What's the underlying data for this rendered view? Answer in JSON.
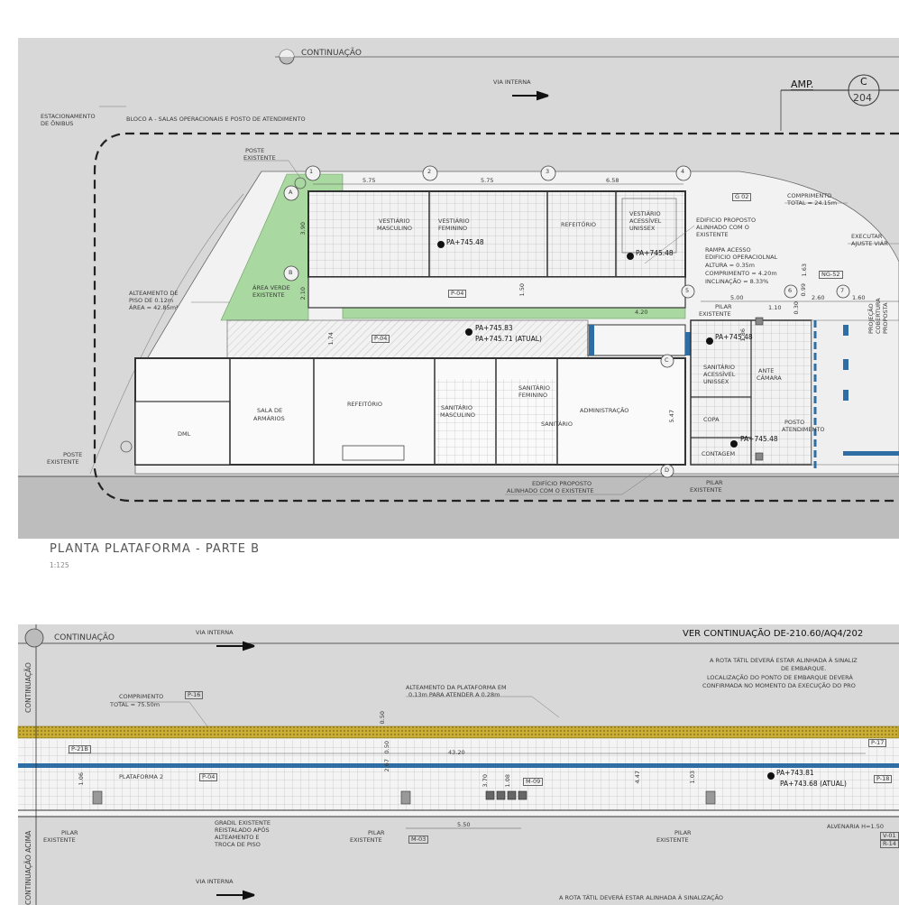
{
  "top": {
    "continuation": "CONTINUAÇÃO",
    "via_interna": "VIA INTERNA",
    "amp_label": "AMP.",
    "amp_letter": "C",
    "amp_number": "204",
    "estacionamento": "ESTACIONAMENTO",
    "de_onibus": "DE ÔNIBUS",
    "bloco": "BLOCO A - SALAS OPERACIONAIS E POSTO DE ATENDIMENTO",
    "poste_existente_1": "POSTE",
    "poste_existente_2": "EXISTENTE",
    "poste_bottom_1": "POSTE",
    "poste_bottom_2": "EXISTENTE",
    "grid_numbers": [
      "1",
      "2",
      "3",
      "4",
      "5",
      "6",
      "7"
    ],
    "grid_letters": [
      "A",
      "B",
      "C",
      "D"
    ],
    "dims": {
      "d1": "5.75",
      "d2": "5.75",
      "d3": "6.58",
      "d420": "4.20",
      "d500": "5.00",
      "d110": "1.10",
      "d260": "2.60",
      "d160": "1.60",
      "v390": "3.90",
      "v210": "2.10",
      "v150": "1.50",
      "v174": "1.74",
      "v186": "1.86",
      "v547": "5.47",
      "v163": "1.63",
      "v099": "0.99",
      "v030": "0.30"
    },
    "alteamento_1": "ALTEAMENTO DE",
    "alteamento_2": "PISO DE 0.12m",
    "alteamento_3": "ÁREA = 42.85m²",
    "area_verde_1": "ÁREA VERDE",
    "area_verde_2": "EXISTENTE",
    "vest_masc_1": "VESTIÁRIO",
    "vest_masc_2": "MASCULINO",
    "vest_fem_1": "VESTIÁRIO",
    "vest_fem_2": "FEMININO",
    "refeitorio": "REFEITÓRIO",
    "vest_acess_1": "VESTIÁRIO",
    "vest_acess_2": "ACESSÍVEL",
    "vest_acess_3": "UNISSEX",
    "pa_1": "PA+745.48",
    "pa_2": "PA+745.48",
    "pa_3": "PA+745.83",
    "pa_4": "PA+745.71  (ATUAL)",
    "pa_5": "PA+745.48",
    "pa_6": "PA+745.48",
    "p04a": "P-04",
    "p04b": "P-04",
    "g02": "G 02",
    "ng52": "NG-52",
    "comprimento_1": "COMPRIMENTO",
    "comprimento_2": "TOTAL = 24.15m",
    "executar_1": "EXECUTAR",
    "executar_2": "AJUSTE VIÁR",
    "edif_prop_1": "EDIFICIO PROPOSTO",
    "edif_prop_2": "ALINHADO COM O",
    "edif_prop_3": "EXISTENTE",
    "rampa_1": "RAMPA ACESSO",
    "rampa_2": "EDIFICIO OPERACIOLNAL",
    "rampa_3": "ALTURA = 0.35m",
    "rampa_4": "COMPRIMENTO = 4.20m",
    "rampa_5": "INCLINAÇÃO = 8.33%",
    "pilar_1": "PILAR",
    "pilar_2": "EXISTENTE",
    "pilar_b1": "PILAR",
    "pilar_b2": "EXISTENTE",
    "dml": "DML",
    "sala_1": "SALA DE",
    "sala_2": "ARMÁRIOS",
    "refeitorio_2": "REFEITÓRIO",
    "sanit_masc_1": "SANITÁRIO",
    "sanit_masc_2": "MASCULINO",
    "sanit_fem_1": "SANITÁRIO",
    "sanit_fem_2": "FEMININO",
    "sanitario": "SANITÁRIO",
    "administracao": "ADMINISTRAÇÃO",
    "sanit_acess_1": "SANITÁRIO",
    "sanit_acess_2": "ACESSÍVEL",
    "sanit_acess_3": "UNISSEX",
    "ante_1": "ANTE",
    "ante_2": "CÂMARA",
    "copa": "COPA",
    "posto_1": "POSTO",
    "posto_2": "ATENDIMENTO",
    "contagem": "CONTAGEM",
    "projecao_1": "PROJEÇÃO",
    "projecao_2": "COBERTURA",
    "projecao_3": "PROPOSTA",
    "edif_bottom_1": "EDIFÍCIO PROPOSTO",
    "edif_bottom_2": "ALINHADO COM O EXISTENTE",
    "title": "PLANTA PLATAFORMA - PARTE B",
    "scale": "1:125"
  },
  "bottom": {
    "continuation": "CONTINUAÇÃO",
    "via_interna": "VIA INTERNA",
    "via_interna_2": "VIA INTERNA",
    "ver_continuacao": "VER CONTINUAÇÃO DE-210.60/AQ4/202",
    "side_continuacao": "CONTINUAÇÃO",
    "side_acima": "CONTINUAÇÃO ACIMA",
    "rota_1": "A ROTA TÁTIL DEVERÁ ESTAR ALINHADA À SINALIZ",
    "rota_2": "DE EMBARQUE.",
    "rota_3": "LOCALIZAÇÃO DO PONTO DE EMBARQUE DEVERÁ",
    "rota_4": "CONFIRMADA NO MOMENTO DA EXECUÇÃO DO PRO",
    "rota_bottom": "A ROTA TÁTIL DEVERÁ ESTAR ALINHADA À SINALIZAÇÃO",
    "alteamento_1": "ALTEAMENTO DA PLATAFORMA EM",
    "alteamento_2": "0.13m PARA ATENDER A 0.28m",
    "comprimento_1": "COMPRIMENTO",
    "comprimento_2": "TOTAL = 75.50m",
    "p16": "P-16",
    "p21b": "P-21B",
    "p04": "P-04",
    "p17": "P-17",
    "p18": "P-18",
    "m09": "M-09",
    "m03": "M-03",
    "plataforma": "PLATAFORMA 2",
    "d4320": "43.20",
    "d550": "5.50",
    "v050": "0.50",
    "v050b": "0.50",
    "v267": "2.67",
    "v106": "1.06",
    "v370": "3.70",
    "v108": "1.08",
    "v447": "4.47",
    "v103": "1.03",
    "pa_1": "PA+743.81",
    "pa_2": "PA+743.68   (ATUAL)",
    "pilar_1a": "PILAR",
    "pilar_1b": "EXISTENTE",
    "pilar_2a": "PILAR",
    "pilar_2b": "EXISTENTE",
    "pilar_3a": "PILAR",
    "pilar_3b": "EXISTENTE",
    "gradil_1": "GRADIL EXISTENTE",
    "gradil_2": "REISTALADO APÓS",
    "gradil_3": "ALTEAMENTO E",
    "gradil_4": "TROCA DE PISO",
    "alvenaria_1": "ALVENARIA  H=1.50",
    "alvenaria_2": "V-01",
    "alvenaria_3": "R-14"
  },
  "colors": {
    "paper": "#ffffff",
    "ground": "#d6d6d6",
    "road": "#b9b9b9",
    "green": "#a9d8a0",
    "tactile": "#c9ad34",
    "blue": "#2f6ea5",
    "line": "#3c3c3c"
  }
}
